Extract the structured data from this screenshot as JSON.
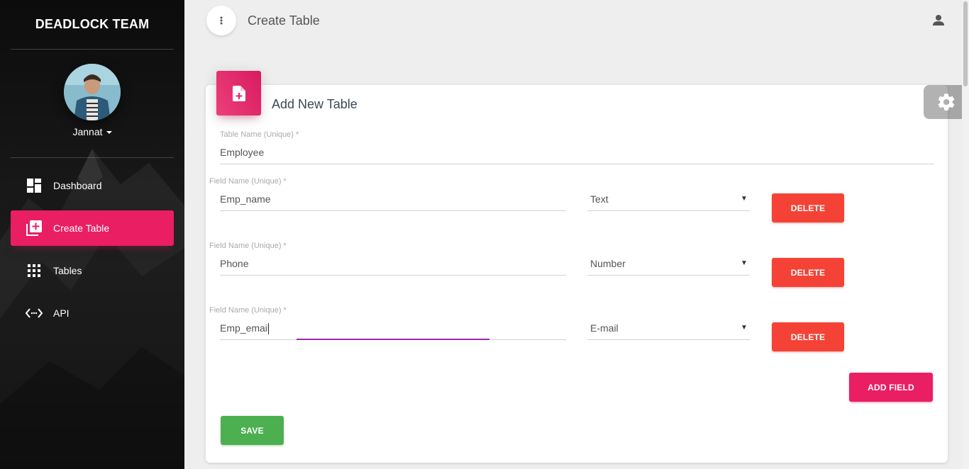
{
  "sidebar": {
    "brand": "DEADLOCK TEAM",
    "user": {
      "name": "Jannat"
    },
    "items": [
      {
        "label": "Dashboard",
        "icon": "dashboard-icon",
        "active": false
      },
      {
        "label": "Create Table",
        "icon": "library-add-icon",
        "active": true
      },
      {
        "label": "Tables",
        "icon": "grid-icon",
        "active": false
      },
      {
        "label": "API",
        "icon": "code-arrows-icon",
        "active": false
      }
    ]
  },
  "topbar": {
    "title": "Create Table"
  },
  "card": {
    "title": "Add New Table",
    "table_name": {
      "label": "Table Name (Unique) *",
      "value": "Employee"
    },
    "fields": [
      {
        "label": "Field Name (Unique) *",
        "value": "Emp_name",
        "type": "Text",
        "delete_label": "DELETE"
      },
      {
        "label": "Field Name (Unique) *",
        "value": "Phone",
        "type": "Number",
        "delete_label": "DELETE"
      },
      {
        "label": "Field Name (Unique) *",
        "value": "Emp_email",
        "type": "E-mail",
        "delete_label": "DELETE"
      }
    ],
    "add_field_label": "ADD FIELD",
    "save_label": "SAVE"
  },
  "colors": {
    "primary": "#e91e63",
    "danger": "#f44336",
    "success": "#4caf50",
    "focus": "#9c27b0"
  }
}
